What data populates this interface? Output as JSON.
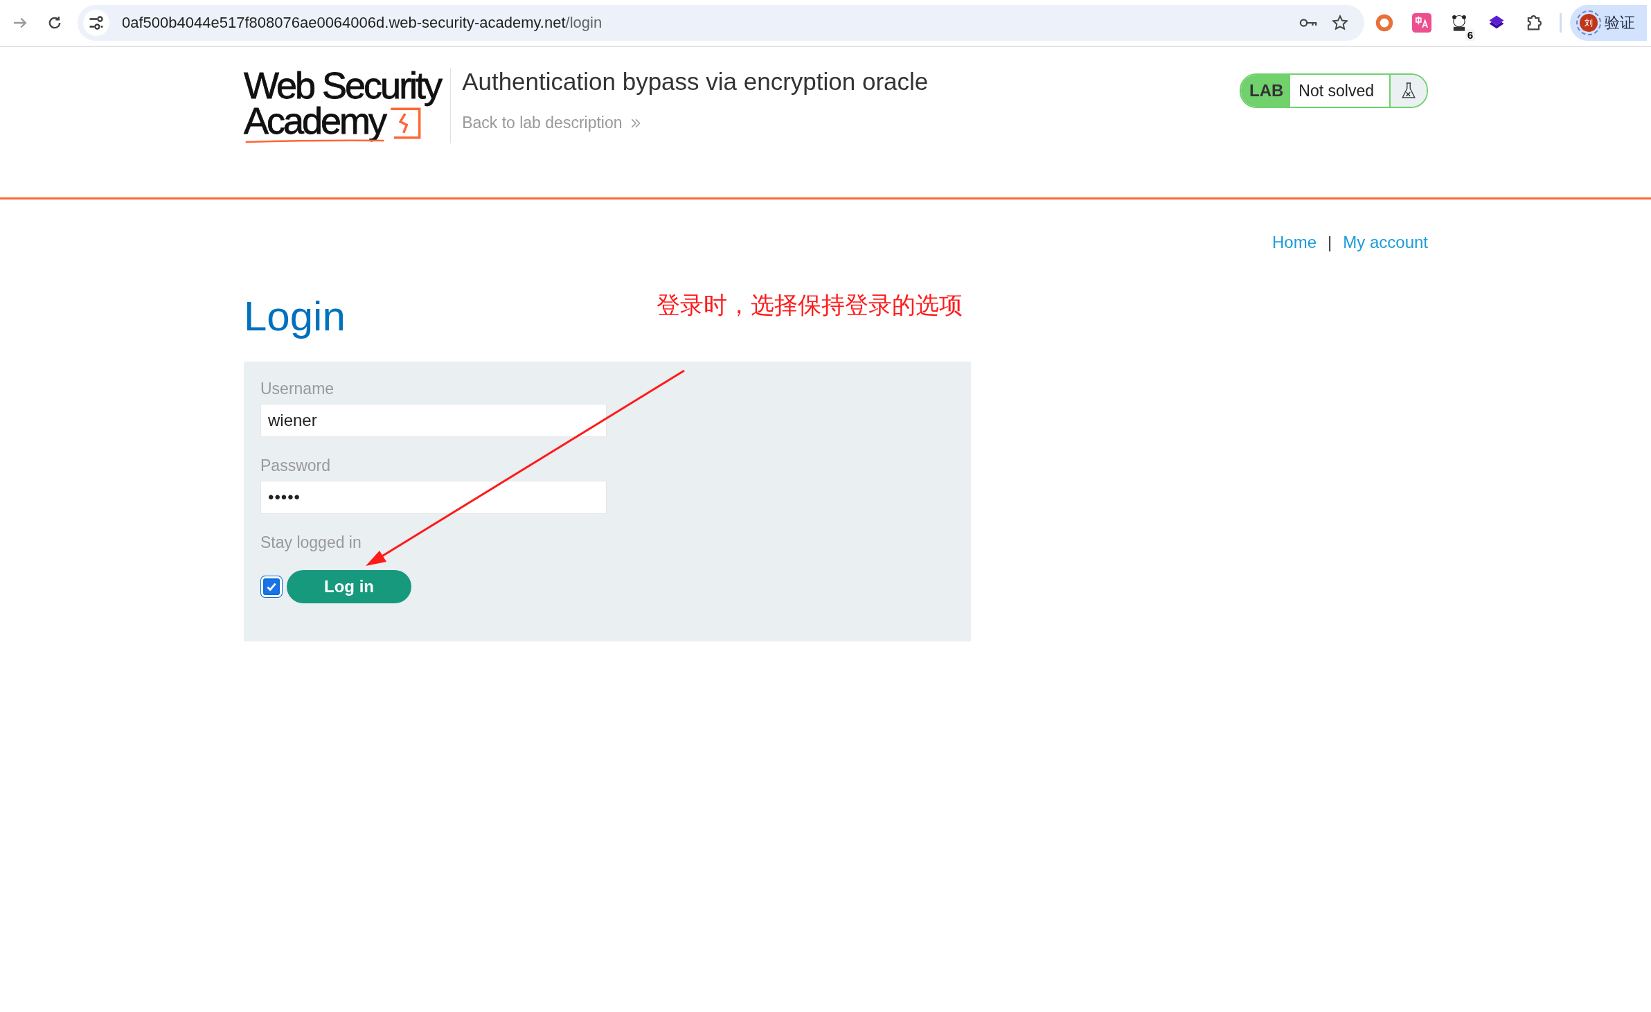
{
  "browser": {
    "url_host": "0af500b4044e517f808076ae0064006d.web-security-academy.net",
    "url_path": "/login",
    "extension_badge": "6",
    "profile_avatar": "刘",
    "profile_label": "验证"
  },
  "header": {
    "logo_lines": [
      "Web Security",
      "Academy"
    ],
    "title": "Authentication bypass via encryption oracle",
    "back_link": "Back to lab description",
    "lab_label": "LAB",
    "status": "Not solved",
    "solved": false
  },
  "nav": [
    "Home",
    "My account"
  ],
  "nav_separator": "|",
  "page": {
    "heading": "Login",
    "annotation": "登录时，选择保持登录的选项"
  },
  "form": {
    "username_label": "Username",
    "username": "wiener",
    "password_label": "Password",
    "password": "•••••",
    "stay_label": "Stay logged in",
    "stay_checked": true,
    "submit": "Log in"
  }
}
